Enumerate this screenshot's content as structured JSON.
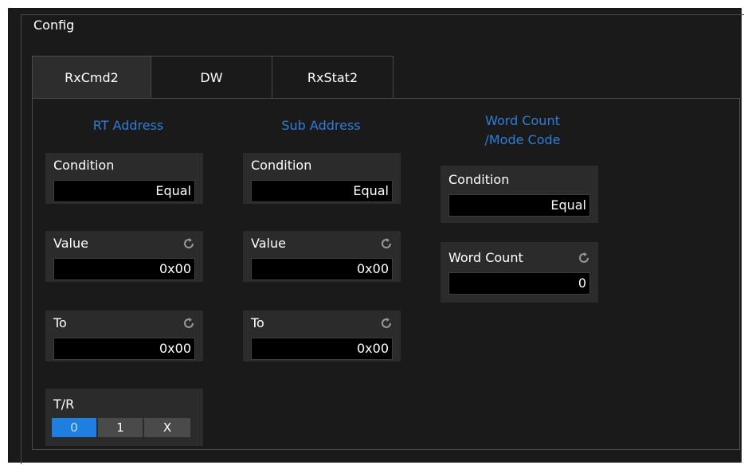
{
  "group": {
    "title": "Config"
  },
  "tabs": [
    {
      "label": "RxCmd2",
      "active": true
    },
    {
      "label": "DW",
      "active": false
    },
    {
      "label": "RxStat2",
      "active": false
    }
  ],
  "rt_address": {
    "title": "RT Address",
    "condition": {
      "label": "Condition",
      "value": "Equal"
    },
    "value": {
      "label": "Value",
      "value": "0x00"
    },
    "to": {
      "label": "To",
      "value": "0x00"
    }
  },
  "sub_address": {
    "title": "Sub Address",
    "condition": {
      "label": "Condition",
      "value": "Equal"
    },
    "value": {
      "label": "Value",
      "value": "0x00"
    },
    "to": {
      "label": "To",
      "value": "0x00"
    }
  },
  "word_count": {
    "title_line1": "Word Count",
    "title_line2": "/Mode Code",
    "condition": {
      "label": "Condition",
      "value": "Equal"
    },
    "count": {
      "label": "Word Count",
      "value": "0"
    }
  },
  "tr": {
    "label": "T/R",
    "options": [
      "0",
      "1",
      "X"
    ],
    "selected": "0"
  },
  "icons": {
    "reset": "reset-icon"
  },
  "colors": {
    "accent": "#2f7dd8",
    "selected": "#1e7fe0",
    "background": "#1a1a1a"
  }
}
